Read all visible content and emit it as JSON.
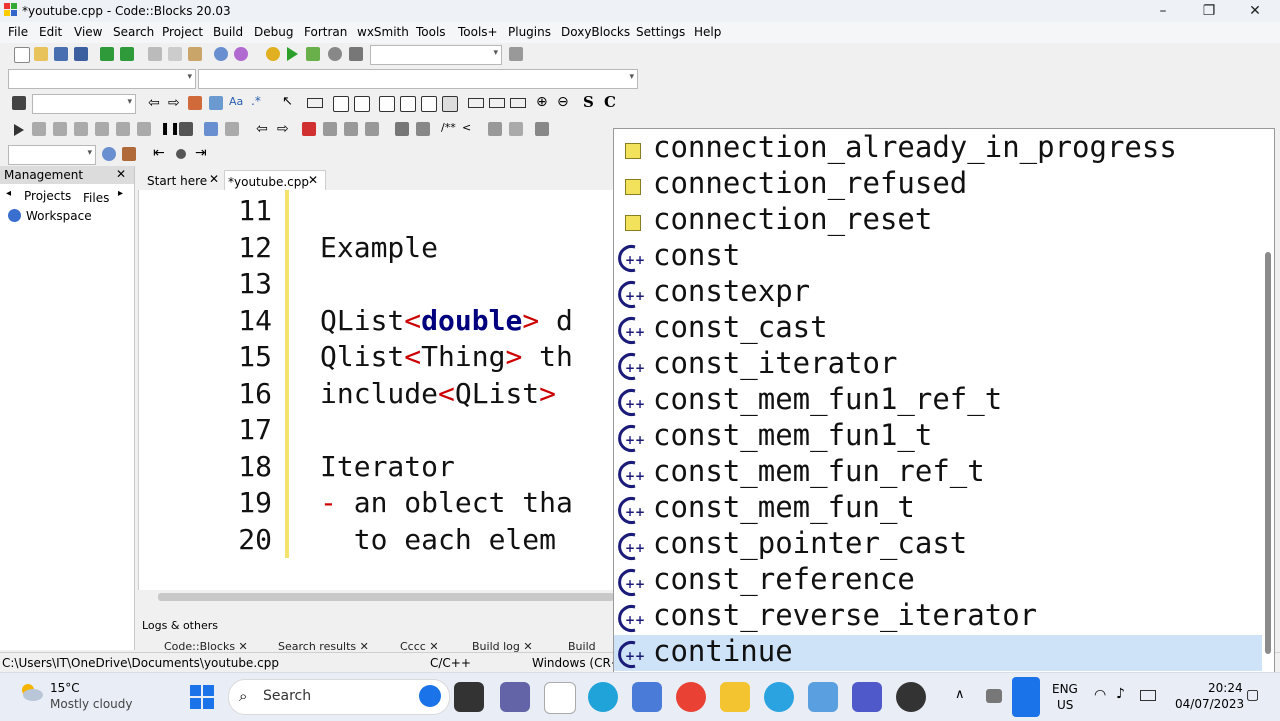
{
  "window": {
    "title": "*youtube.cpp - Code::Blocks 20.03"
  },
  "menu": [
    "File",
    "Edit",
    "View",
    "Search",
    "Project",
    "Build",
    "Debug",
    "Fortran",
    "wxSmith",
    "Tools",
    "Tools+",
    "Plugins",
    "DoxyBlocks",
    "Settings",
    "Help"
  ],
  "management": {
    "title": "Management",
    "tabs": [
      "Projects",
      "Files"
    ],
    "workspace": "Workspace"
  },
  "editor": {
    "tabs": [
      "Start here",
      "*youtube.cpp"
    ],
    "lines": [
      {
        "n": "11",
        "parts": []
      },
      {
        "n": "12",
        "parts": [
          {
            "t": "Example",
            "c": ""
          }
        ]
      },
      {
        "n": "13",
        "parts": []
      },
      {
        "n": "14",
        "parts": [
          {
            "t": "QList",
            "c": ""
          },
          {
            "t": "<",
            "c": "op"
          },
          {
            "t": "double",
            "c": "kw"
          },
          {
            "t": ">",
            "c": "op"
          },
          {
            "t": " d",
            "c": ""
          }
        ]
      },
      {
        "n": "15",
        "parts": [
          {
            "t": "Qlist",
            "c": ""
          },
          {
            "t": "<",
            "c": "op"
          },
          {
            "t": "Thing",
            "c": ""
          },
          {
            "t": ">",
            "c": "op"
          },
          {
            "t": " th",
            "c": ""
          }
        ]
      },
      {
        "n": "16",
        "parts": [
          {
            "t": "include",
            "c": ""
          },
          {
            "t": "<",
            "c": "op"
          },
          {
            "t": "QList",
            "c": ""
          },
          {
            "t": ">",
            "c": "op"
          }
        ]
      },
      {
        "n": "17",
        "parts": []
      },
      {
        "n": "18",
        "parts": [
          {
            "t": "Iterator",
            "c": ""
          }
        ]
      },
      {
        "n": "19",
        "parts": [
          {
            "t": "-",
            "c": "op"
          },
          {
            "t": " an oblect tha",
            "c": ""
          }
        ]
      },
      {
        "n": "20",
        "parts": [
          {
            "t": "  to each elem",
            "c": ""
          }
        ]
      }
    ]
  },
  "logs": {
    "title": "Logs & others",
    "tabs": [
      "Code::Blocks",
      "Search results",
      "Cccc",
      "Build log",
      "Build"
    ]
  },
  "status": {
    "path": "C:\\Users\\IT\\OneDrive\\Documents\\youtube.cpp",
    "lang": "C/C++",
    "eol": "Windows (CR+"
  },
  "autocomplete": [
    {
      "label": "connection_already_in_progress",
      "kind": "enum"
    },
    {
      "label": "connection_refused",
      "kind": "enum"
    },
    {
      "label": "connection_reset",
      "kind": "enum"
    },
    {
      "label": "const",
      "kind": "keyword"
    },
    {
      "label": "constexpr",
      "kind": "keyword"
    },
    {
      "label": "const_cast",
      "kind": "keyword"
    },
    {
      "label": "const_iterator",
      "kind": "keyword"
    },
    {
      "label": "const_mem_fun1_ref_t",
      "kind": "keyword"
    },
    {
      "label": "const_mem_fun1_t",
      "kind": "keyword"
    },
    {
      "label": "const_mem_fun_ref_t",
      "kind": "keyword"
    },
    {
      "label": "const_mem_fun_t",
      "kind": "keyword"
    },
    {
      "label": "const_pointer_cast",
      "kind": "keyword"
    },
    {
      "label": "const_reference",
      "kind": "keyword"
    },
    {
      "label": "const_reverse_iterator",
      "kind": "keyword"
    },
    {
      "label": "continue",
      "kind": "keyword",
      "selected": true
    }
  ],
  "taskbar": {
    "weather": {
      "temp": "15°C",
      "desc": "Mostly cloudy"
    },
    "search_label": "Search",
    "lang": "ENG",
    "region": "US",
    "time": "20:24",
    "date": "04/07/2023"
  },
  "colors": {
    "keyword": "#00007f",
    "operator": "#cc0000",
    "selection": "#cfe3f8",
    "changebar": "#f3e36a"
  }
}
